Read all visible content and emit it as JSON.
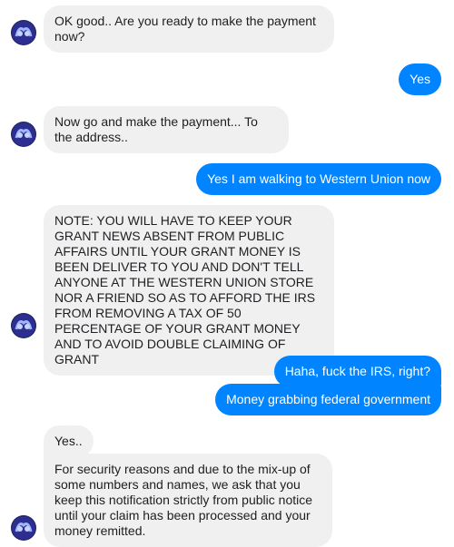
{
  "messages": [
    {
      "text": "OK good.. Are you ready to make the payment now?"
    },
    {
      "text": "Yes"
    },
    {
      "text": "Now go and make the payment... To the address.."
    },
    {
      "text": "Yes I am walking to Western Union now"
    },
    {
      "text": "NOTE: YOU WILL HAVE TO KEEP YOUR GRANT NEWS ABSENT FROM PUBLIC AFFAIRS UNTIL YOUR GRANT MONEY IS BEEN DELIVER TO YOU AND DON'T TELL ANYONE AT THE WESTERN UNION STORE NOR A FRIEND SO AS TO AFFORD THE IRS FROM REMOVING A TAX OF 50 PERCENTAGE OF YOUR GRANT MONEY AND TO AVOID DOUBLE CLAIMING OF GRANT"
    },
    {
      "text": "Haha, fuck the IRS, right?"
    },
    {
      "text": "Money grabbing federal government"
    },
    {
      "text": "Yes.."
    },
    {
      "text": "For security reasons and due to the mix-up of some numbers and names, we ask that you keep this notification strictly from public notice until your claim has been processed and your money remitted."
    }
  ],
  "colors": {
    "incoming_bubble": "#f1f0f0",
    "outgoing_bubble": "#0084ff",
    "avatar": "#2c2f8f"
  }
}
